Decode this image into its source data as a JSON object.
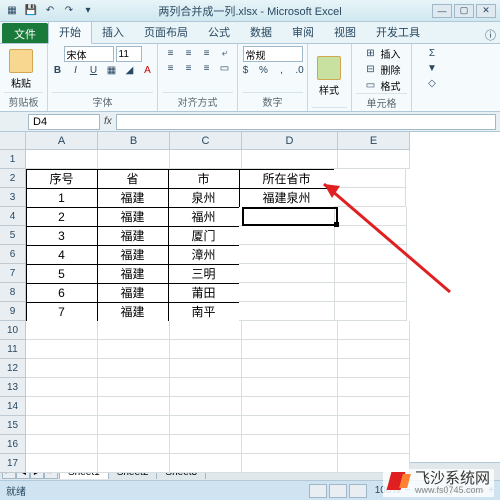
{
  "window": {
    "title": "两列合并成一列.xlsx - Microsoft Excel",
    "app": "Microsoft Excel"
  },
  "qat": {
    "save": "💾",
    "undo": "↶",
    "redo": "↷",
    "down": "▾"
  },
  "tabs": {
    "file": "文件",
    "home": "开始",
    "insert": "插入",
    "layout": "页面布局",
    "formulas": "公式",
    "data": "数据",
    "review": "审阅",
    "view": "视图",
    "dev": "开发工具",
    "help": "ⓘ"
  },
  "ribbon": {
    "clipboard": {
      "label": "剪贴板",
      "paste": "粘贴"
    },
    "font": {
      "label": "字体",
      "name": "宋体",
      "size": "11",
      "bold": "B",
      "italic": "I",
      "underline": "U"
    },
    "align": {
      "label": "对齐方式"
    },
    "number": {
      "label": "数字",
      "format": "常规"
    },
    "styles": {
      "label": "样式"
    },
    "cells": {
      "label": "单元格",
      "insert": "插入",
      "delete": "删除",
      "format": "格式"
    },
    "editing": {
      "label": ""
    }
  },
  "namebox": "D4",
  "cols": [
    "A",
    "B",
    "C",
    "D",
    "E"
  ],
  "rows": [
    "1",
    "2",
    "3",
    "4",
    "5",
    "6",
    "7",
    "8",
    "9",
    "10",
    "11",
    "12",
    "13",
    "14",
    "15",
    "16",
    "17"
  ],
  "table": {
    "headers": {
      "A": "序号",
      "B": "省",
      "C": "市",
      "D": "所在省市"
    },
    "data": [
      {
        "A": "1",
        "B": "福建",
        "C": "泉州",
        "D": "福建泉州"
      },
      {
        "A": "2",
        "B": "福建",
        "C": "福州",
        "D": ""
      },
      {
        "A": "3",
        "B": "福建",
        "C": "厦门",
        "D": ""
      },
      {
        "A": "4",
        "B": "福建",
        "C": "漳州",
        "D": ""
      },
      {
        "A": "5",
        "B": "福建",
        "C": "三明",
        "D": ""
      },
      {
        "A": "6",
        "B": "福建",
        "C": "莆田",
        "D": ""
      },
      {
        "A": "7",
        "B": "福建",
        "C": "南平",
        "D": ""
      }
    ]
  },
  "sheets": {
    "s1": "Sheet1",
    "s2": "Sheet2",
    "s3": "Sheet3"
  },
  "status": {
    "ready": "就绪",
    "zoom": "100%"
  },
  "watermark": {
    "name": "飞沙系统网",
    "url": "www.fs0745.com"
  }
}
